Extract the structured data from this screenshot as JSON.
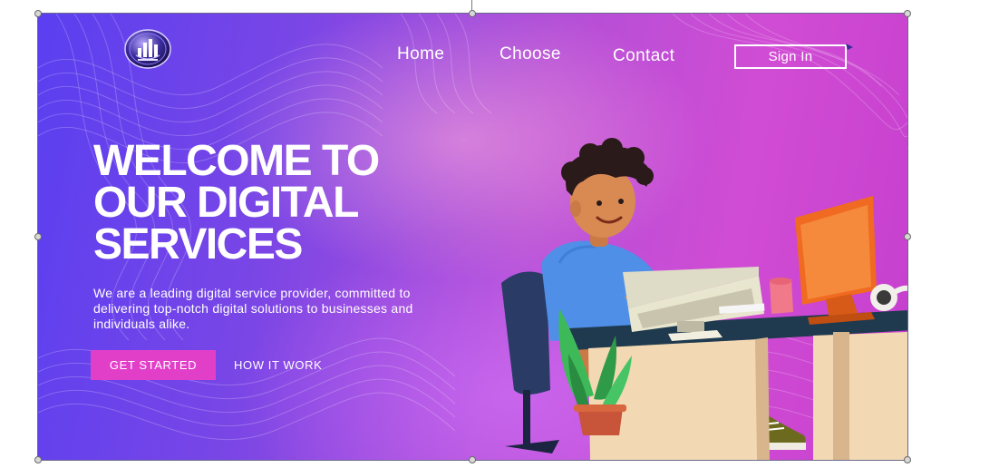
{
  "nav": {
    "links": [
      {
        "label": "Home"
      },
      {
        "label": "Choose"
      },
      {
        "label": "Contact"
      }
    ],
    "sign_in_label": "Sign In",
    "logo_icon": "bar-chart-logo-icon"
  },
  "hero": {
    "title_lines": [
      "WELCOME TO",
      "OUR DIGITAL",
      "SERVICES"
    ],
    "description": "We are a leading digital service provider, committed to delivering top-notch digital solutions to businesses and individuals alike.",
    "primary_button_label": "GET STARTED",
    "secondary_button_label": "HOW IT WORK"
  },
  "illustration": {
    "subject": "person-at-desk-illustration",
    "items": [
      "person-icon",
      "chair-icon",
      "desk-icon",
      "monitor-icon",
      "laptop-icon",
      "mug-icon",
      "headphones-icon",
      "plant-icon"
    ]
  },
  "colors": {
    "gradient_left": "#5a3ff0",
    "gradient_right": "#c53fce",
    "primary_button": "#e23fc9",
    "text": "#ffffff"
  }
}
